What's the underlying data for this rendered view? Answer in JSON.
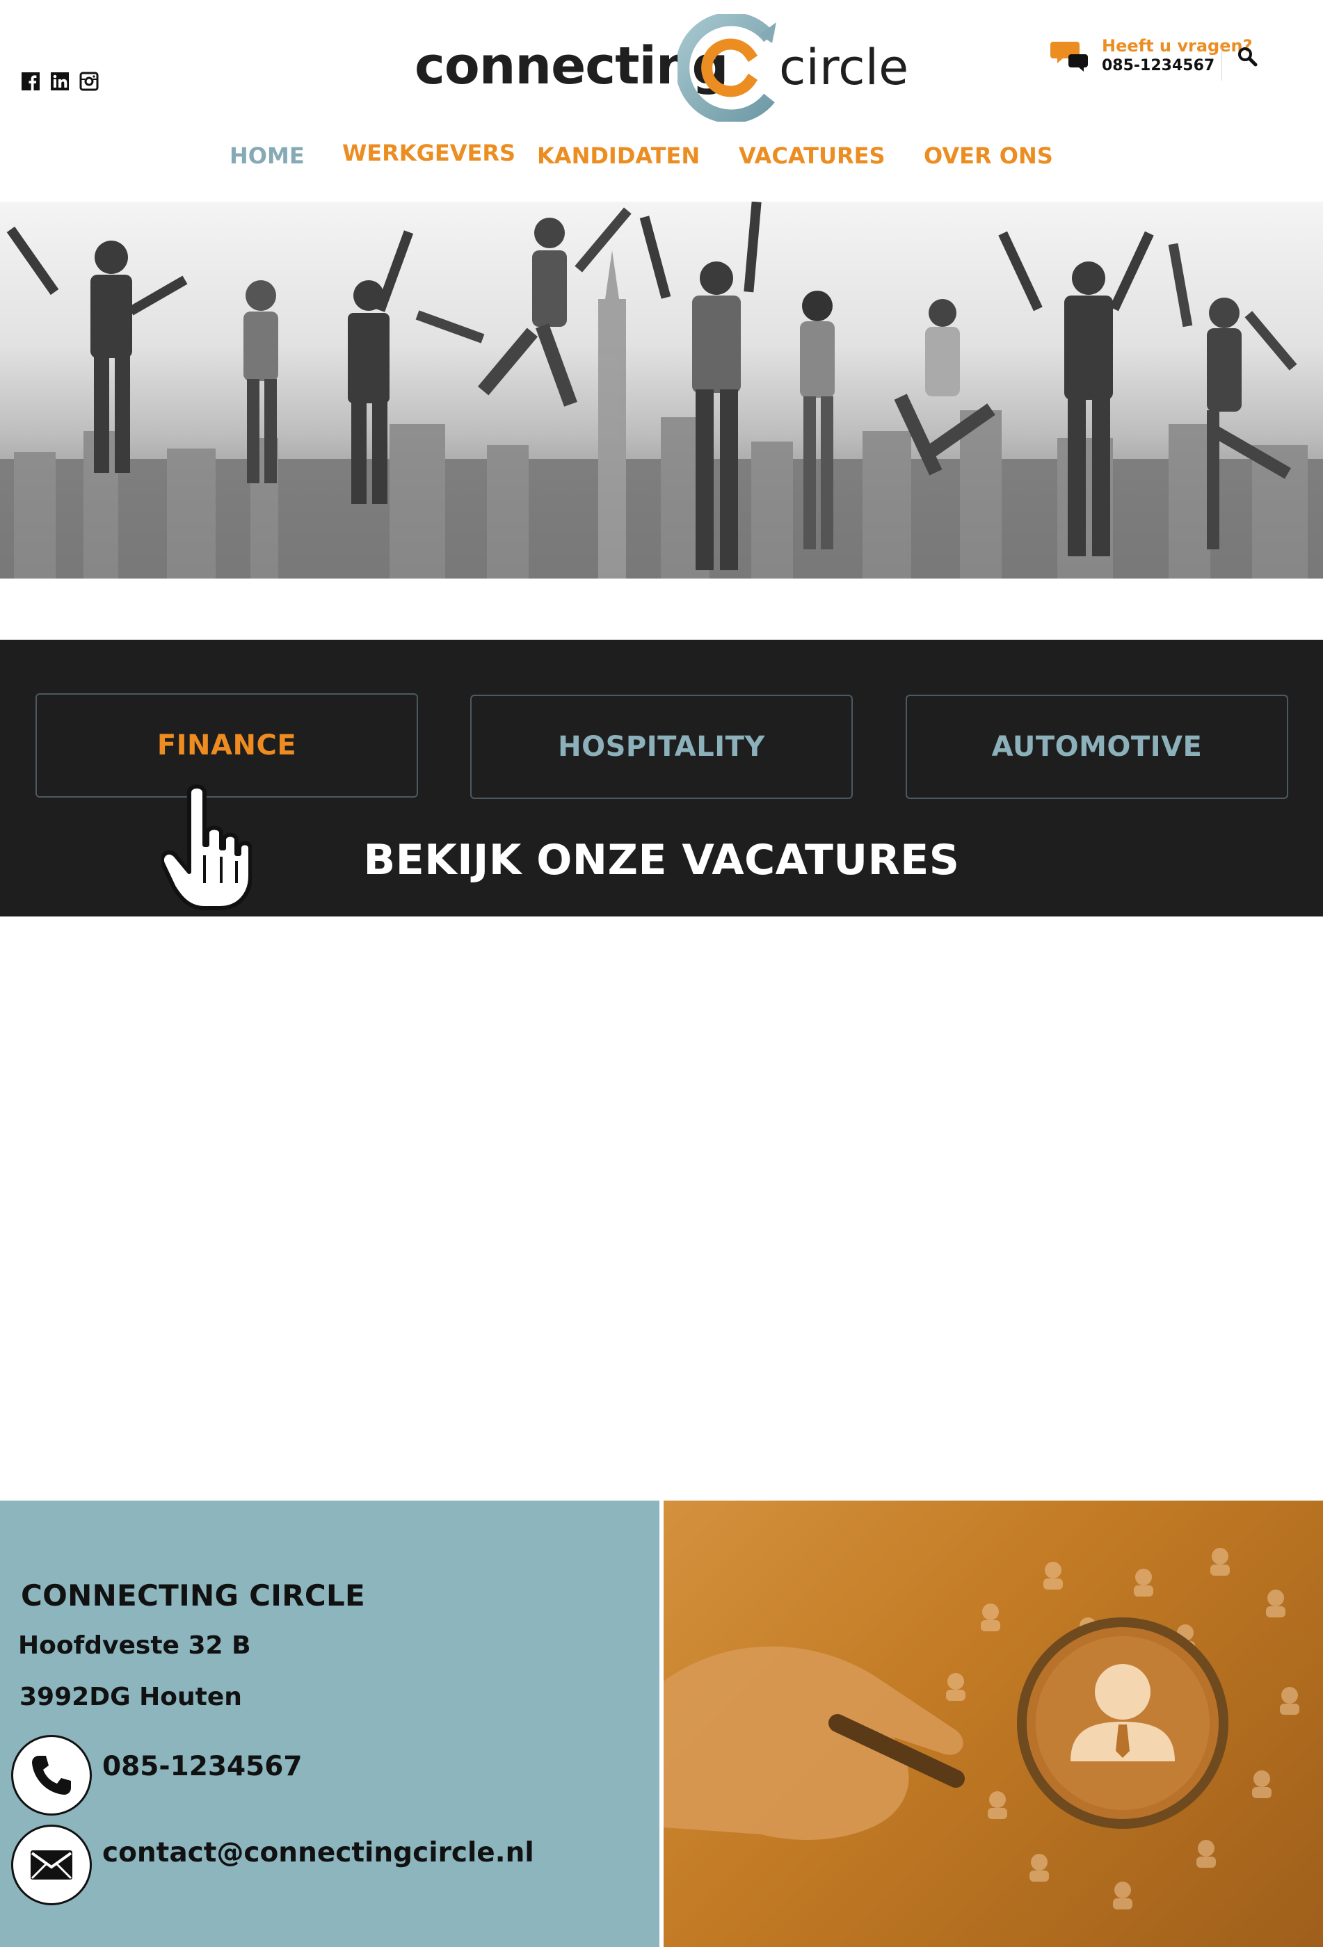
{
  "header": {
    "logo": {
      "left_word": "connecting",
      "right_word": "circle"
    },
    "social": [
      "facebook-icon",
      "linkedin-icon",
      "instagram-icon"
    ],
    "contact": {
      "question": "Heeft u vragen?",
      "phone": "085-1234567"
    }
  },
  "nav": {
    "items": [
      {
        "label": "HOME",
        "active": true
      },
      {
        "label": "WERKGEVERS",
        "active": false
      },
      {
        "label": "KANDIDATEN",
        "active": false
      },
      {
        "label": "VACATURES",
        "active": false
      },
      {
        "label": "OVER ONS",
        "active": false
      }
    ]
  },
  "categories": {
    "items": [
      {
        "label": "FINANCE",
        "highlighted": true
      },
      {
        "label": "HOSPITALITY",
        "highlighted": false
      },
      {
        "label": "AUTOMOTIVE",
        "highlighted": false
      }
    ],
    "cta": "BEKIJK ONZE VACATURES"
  },
  "footer": {
    "company": "CONNECTING CIRCLE",
    "street": "Hoofdveste 32 B",
    "city": "3992DG Houten",
    "phone": "085-1234567",
    "email": "contact@connectingcircle.nl"
  },
  "colors": {
    "accent_orange": "#ec8d22",
    "accent_blue": "#86aab5",
    "band_dark": "#1e1e1e",
    "footer_blue": "#8cb5bd"
  }
}
